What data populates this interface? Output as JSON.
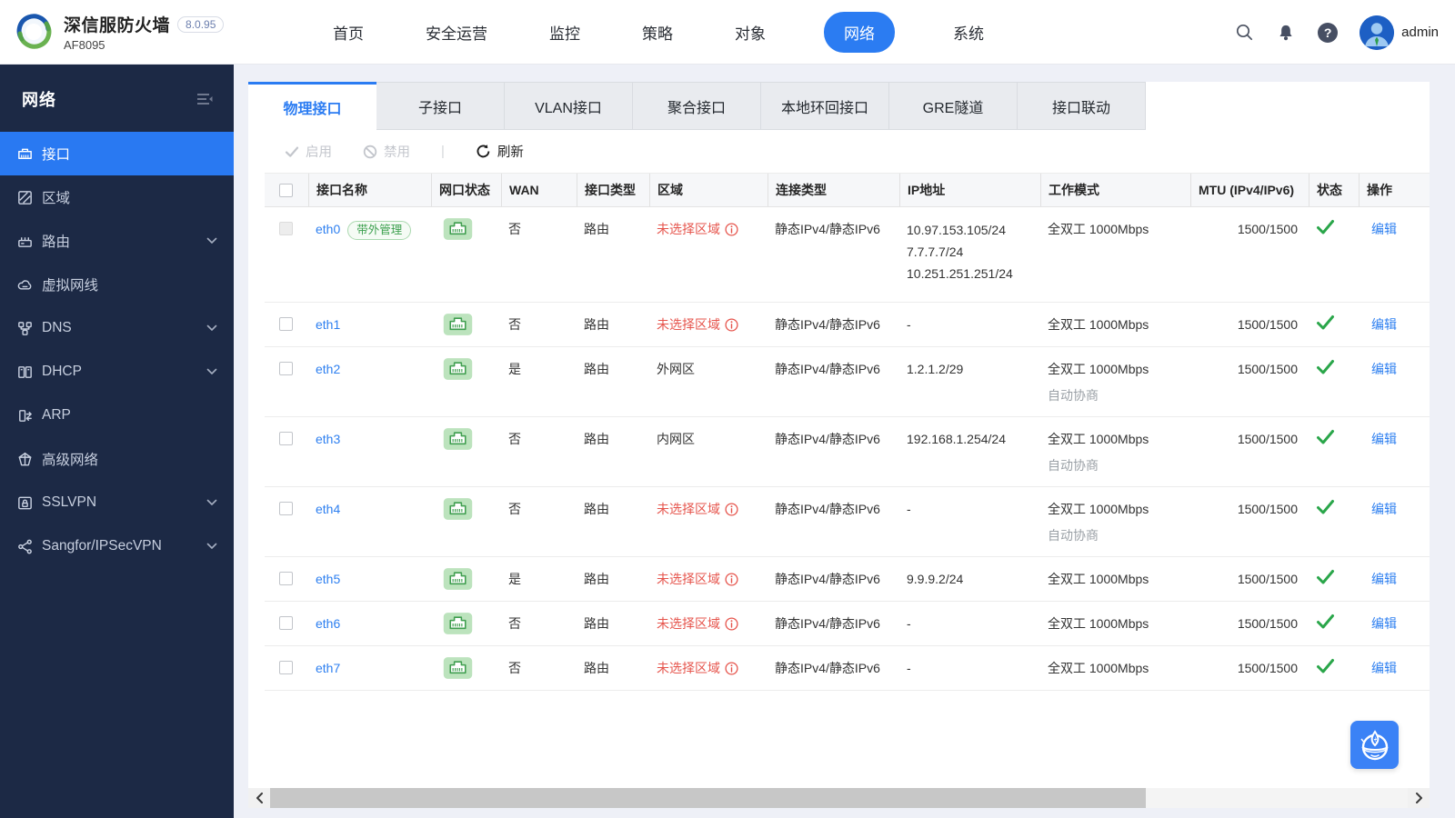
{
  "topbar": {
    "title": "深信服防火墙",
    "version": "8.0.95",
    "model": "AF8095",
    "nav": [
      {
        "label": "首页",
        "active": false
      },
      {
        "label": "安全运营",
        "active": false
      },
      {
        "label": "监控",
        "active": false
      },
      {
        "label": "策略",
        "active": false
      },
      {
        "label": "对象",
        "active": false
      },
      {
        "label": "网络",
        "active": true
      },
      {
        "label": "系统",
        "active": false
      }
    ],
    "admin": "admin"
  },
  "sidebar": {
    "title": "网络",
    "items": [
      {
        "label": "接口",
        "icon": "port",
        "active": true,
        "chevron": false
      },
      {
        "label": "区域",
        "icon": "zone",
        "active": false,
        "chevron": false
      },
      {
        "label": "路由",
        "icon": "route",
        "active": false,
        "chevron": true
      },
      {
        "label": "虚拟网线",
        "icon": "vwire",
        "active": false,
        "chevron": false
      },
      {
        "label": "DNS",
        "icon": "dns",
        "active": false,
        "chevron": true
      },
      {
        "label": "DHCP",
        "icon": "dhcp",
        "active": false,
        "chevron": true
      },
      {
        "label": "ARP",
        "icon": "arp",
        "active": false,
        "chevron": false
      },
      {
        "label": "高级网络",
        "icon": "advnet",
        "active": false,
        "chevron": false
      },
      {
        "label": "SSLVPN",
        "icon": "sslvpn",
        "active": false,
        "chevron": true
      },
      {
        "label": "Sangfor/IPSecVPN",
        "icon": "ipsec",
        "active": false,
        "chevron": true
      }
    ]
  },
  "tabs": [
    {
      "label": "物理接口",
      "active": true
    },
    {
      "label": "子接口",
      "active": false
    },
    {
      "label": "VLAN接口",
      "active": false
    },
    {
      "label": "聚合接口",
      "active": false
    },
    {
      "label": "本地环回接口",
      "active": false
    },
    {
      "label": "GRE隧道",
      "active": false
    },
    {
      "label": "接口联动",
      "active": false
    }
  ],
  "toolbar": {
    "enable_label": "启用",
    "disable_label": "禁用",
    "refresh_label": "刷新"
  },
  "table": {
    "headers": [
      "接口名称",
      "网口状态",
      "WAN",
      "接口类型",
      "区域",
      "连接类型",
      "IP地址",
      "工作模式",
      "MTU (IPv4/IPv6)",
      "状态",
      "操作"
    ],
    "rows": [
      {
        "name": "eth0",
        "badge": "带外管理",
        "checkbox_disabled": true,
        "wan": "否",
        "type": "路由",
        "zone": "未选择区域",
        "zone_alert": true,
        "conn": "静态IPv4/静态IPv6",
        "ip": [
          "10.97.153.105/24",
          "7.7.7.7/24",
          "10.251.251.251/24"
        ],
        "mode": "全双工 1000Mbps",
        "mode_sub": "",
        "mtu": "1500/1500",
        "status": "ok",
        "action": "编辑"
      },
      {
        "name": "eth1",
        "badge": "",
        "checkbox_disabled": false,
        "wan": "否",
        "type": "路由",
        "zone": "未选择区域",
        "zone_alert": true,
        "conn": "静态IPv4/静态IPv6",
        "ip": [
          "-"
        ],
        "mode": "全双工 1000Mbps",
        "mode_sub": "",
        "mtu": "1500/1500",
        "status": "ok",
        "action": "编辑"
      },
      {
        "name": "eth2",
        "badge": "",
        "checkbox_disabled": false,
        "wan": "是",
        "type": "路由",
        "zone": "外网区",
        "zone_alert": false,
        "conn": "静态IPv4/静态IPv6",
        "ip": [
          "1.2.1.2/29"
        ],
        "mode": "全双工 1000Mbps",
        "mode_sub": "自动协商",
        "mtu": "1500/1500",
        "status": "ok",
        "action": "编辑"
      },
      {
        "name": "eth3",
        "badge": "",
        "checkbox_disabled": false,
        "wan": "否",
        "type": "路由",
        "zone": "内网区",
        "zone_alert": false,
        "conn": "静态IPv4/静态IPv6",
        "ip": [
          "192.168.1.254/24"
        ],
        "mode": "全双工 1000Mbps",
        "mode_sub": "自动协商",
        "mtu": "1500/1500",
        "status": "ok",
        "action": "编辑"
      },
      {
        "name": "eth4",
        "badge": "",
        "checkbox_disabled": false,
        "wan": "否",
        "type": "路由",
        "zone": "未选择区域",
        "zone_alert": true,
        "conn": "静态IPv4/静态IPv6",
        "ip": [
          "-"
        ],
        "mode": "全双工 1000Mbps",
        "mode_sub": "自动协商",
        "mtu": "1500/1500",
        "status": "ok",
        "action": "编辑"
      },
      {
        "name": "eth5",
        "badge": "",
        "checkbox_disabled": false,
        "wan": "是",
        "type": "路由",
        "zone": "未选择区域",
        "zone_alert": true,
        "conn": "静态IPv4/静态IPv6",
        "ip": [
          "9.9.9.2/24"
        ],
        "mode": "全双工 1000Mbps",
        "mode_sub": "",
        "mtu": "1500/1500",
        "status": "ok",
        "action": "编辑"
      },
      {
        "name": "eth6",
        "badge": "",
        "checkbox_disabled": false,
        "wan": "否",
        "type": "路由",
        "zone": "未选择区域",
        "zone_alert": true,
        "conn": "静态IPv4/静态IPv6",
        "ip": [
          "-"
        ],
        "mode": "全双工 1000Mbps",
        "mode_sub": "",
        "mtu": "1500/1500",
        "status": "ok",
        "action": "编辑"
      },
      {
        "name": "eth7",
        "badge": "",
        "checkbox_disabled": false,
        "wan": "否",
        "type": "路由",
        "zone": "未选择区域",
        "zone_alert": true,
        "conn": "静态IPv4/静态IPv6",
        "ip": [
          "-"
        ],
        "mode": "全双工 1000Mbps",
        "mode_sub": "",
        "mtu": "1500/1500",
        "status": "ok",
        "action": "编辑"
      }
    ]
  },
  "colors": {
    "accent_blue": "#2b7cf2",
    "sidebar_navy": "#1c2945",
    "link_blue": "#2d7ff0",
    "alert_red": "#e6554d",
    "ok_green": "#2aa64a",
    "port_green_bg": "#bce3bd",
    "port_green_stroke": "#3f9e4f"
  }
}
